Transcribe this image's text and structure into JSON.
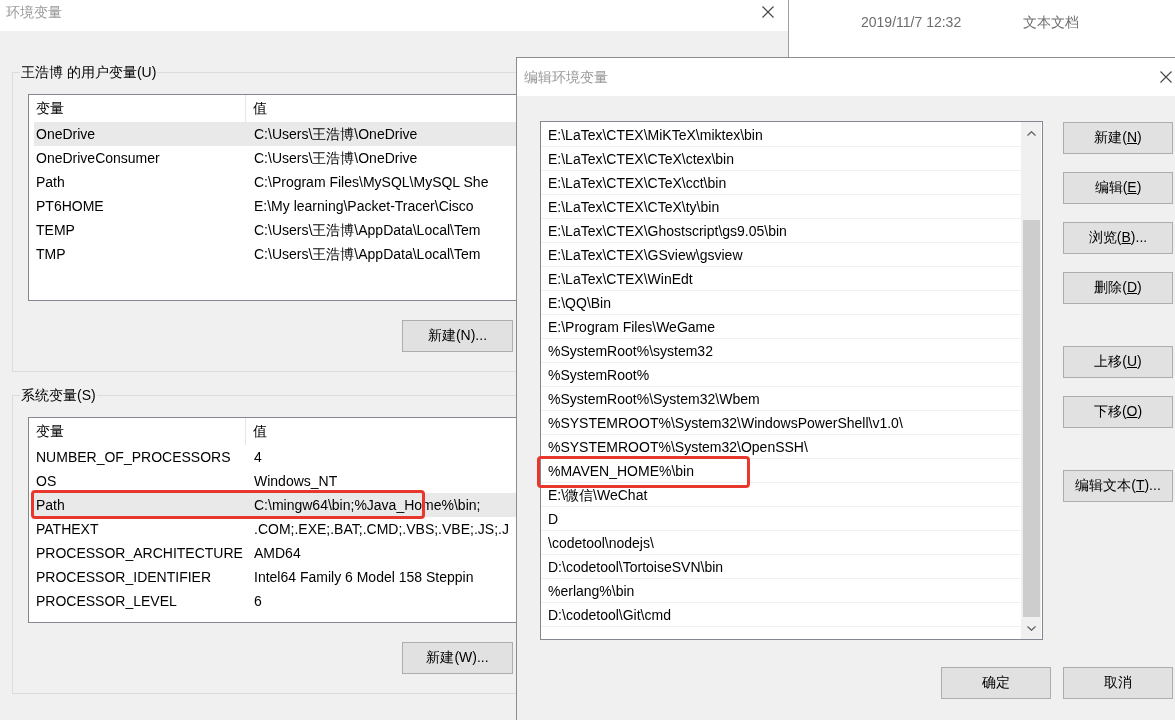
{
  "explorer": {
    "files": [
      {
        "modified": "2019/11/7 12:32",
        "type": "文本文档"
      }
    ]
  },
  "env_window": {
    "title": "环境变量",
    "user_variables": {
      "label": "王浩博 的用户变量(U)",
      "columns": [
        "变量",
        "值"
      ],
      "rows": [
        {
          "name": "OneDrive",
          "value": "C:\\Users\\王浩博\\OneDrive",
          "selected": true
        },
        {
          "name": "OneDriveConsumer",
          "value": "C:\\Users\\王浩博\\OneDrive",
          "selected": false
        },
        {
          "name": "Path",
          "value": "C:\\Program Files\\MySQL\\MySQL She",
          "selected": false
        },
        {
          "name": "PT6HOME",
          "value": "E:\\My learning\\Packet-Tracer\\Cisco",
          "selected": false
        },
        {
          "name": "TEMP",
          "value": "C:\\Users\\王浩博\\AppData\\Local\\Tem",
          "selected": false
        },
        {
          "name": "TMP",
          "value": "C:\\Users\\王浩博\\AppData\\Local\\Tem",
          "selected": false
        }
      ],
      "new_button": "新建(N)..."
    },
    "system_variables": {
      "label": "系统变量(S)",
      "columns": [
        "变量",
        "值"
      ],
      "rows": [
        {
          "name": "NUMBER_OF_PROCESSORS",
          "value": "4",
          "selected": false,
          "annotated": false
        },
        {
          "name": "OS",
          "value": "Windows_NT",
          "selected": false,
          "annotated": false
        },
        {
          "name": "Path",
          "value": "C:\\mingw64\\bin;%Java_Home%\\bin;",
          "selected": true,
          "annotated": true
        },
        {
          "name": "PATHEXT",
          "value": ".COM;.EXE;.BAT;.CMD;.VBS;.VBE;.JS;.J",
          "selected": false,
          "annotated": false
        },
        {
          "name": "PROCESSOR_ARCHITECTURE",
          "value": "AMD64",
          "selected": false,
          "annotated": false
        },
        {
          "name": "PROCESSOR_IDENTIFIER",
          "value": "Intel64 Family 6 Model 158 Steppin",
          "selected": false,
          "annotated": false
        },
        {
          "name": "PROCESSOR_LEVEL",
          "value": "6",
          "selected": false,
          "annotated": false
        }
      ],
      "new_button": "新建(W)..."
    }
  },
  "edit_dialog": {
    "title": "编辑环境变量",
    "entries": [
      {
        "text": "E:\\LaTex\\CTEX\\MiKTeX\\miktex\\bin",
        "selected": false,
        "annotated": false
      },
      {
        "text": "E:\\LaTex\\CTEX\\CTeX\\ctex\\bin",
        "selected": false,
        "annotated": false
      },
      {
        "text": "E:\\LaTex\\CTEX\\CTeX\\cct\\bin",
        "selected": false,
        "annotated": false
      },
      {
        "text": "E:\\LaTex\\CTEX\\CTeX\\ty\\bin",
        "selected": false,
        "annotated": false
      },
      {
        "text": "E:\\LaTex\\CTEX\\Ghostscript\\gs9.05\\bin",
        "selected": false,
        "annotated": false
      },
      {
        "text": "E:\\LaTex\\CTEX\\GSview\\gsview",
        "selected": false,
        "annotated": false
      },
      {
        "text": "E:\\LaTex\\CTEX\\WinEdt",
        "selected": false,
        "annotated": false
      },
      {
        "text": "E:\\QQ\\Bin",
        "selected": false,
        "annotated": false
      },
      {
        "text": "E:\\Program Files\\WeGame",
        "selected": false,
        "annotated": false
      },
      {
        "text": "%SystemRoot%\\system32",
        "selected": false,
        "annotated": false
      },
      {
        "text": "%SystemRoot%",
        "selected": false,
        "annotated": false
      },
      {
        "text": "%SystemRoot%\\System32\\Wbem",
        "selected": false,
        "annotated": false
      },
      {
        "text": "%SYSTEMROOT%\\System32\\WindowsPowerShell\\v1.0\\",
        "selected": false,
        "annotated": false
      },
      {
        "text": "%SYSTEMROOT%\\System32\\OpenSSH\\",
        "selected": false,
        "annotated": false
      },
      {
        "text": "%MAVEN_HOME%\\bin",
        "selected": false,
        "annotated": true
      },
      {
        "text": "E:\\微信\\WeChat",
        "selected": false,
        "annotated": false
      },
      {
        "text": "D",
        "selected": false,
        "annotated": false
      },
      {
        "text": "\\codetool\\nodejs\\",
        "selected": false,
        "annotated": false
      },
      {
        "text": "D:\\codetool\\TortoiseSVN\\bin",
        "selected": false,
        "annotated": false
      },
      {
        "text": "%erlang%\\bin",
        "selected": false,
        "annotated": false
      },
      {
        "text": "D:\\codetool\\Git\\cmd",
        "selected": false,
        "annotated": false
      }
    ],
    "button_groups": [
      [
        {
          "text": "新建(",
          "access_key": "N",
          "suffix": ")"
        },
        {
          "text": "编辑(",
          "access_key": "E",
          "suffix": ")"
        },
        {
          "text": "浏览(",
          "access_key": "B",
          "suffix": ")..."
        },
        {
          "text": "删除(",
          "access_key": "D",
          "suffix": ")"
        }
      ],
      [
        {
          "text": "上移(",
          "access_key": "U",
          "suffix": ")"
        },
        {
          "text": "下移(",
          "access_key": "O",
          "suffix": ")"
        }
      ],
      [
        {
          "text": "编辑文本(",
          "access_key": "T",
          "suffix": ")..."
        }
      ]
    ],
    "ok_button": "确定",
    "cancel_button": "取消"
  }
}
